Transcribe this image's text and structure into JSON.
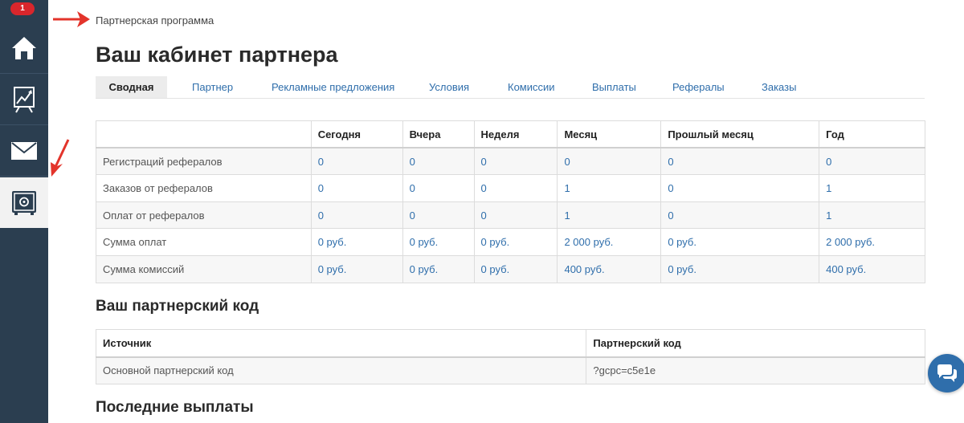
{
  "sidebar": {
    "badge": "1",
    "items": [
      {
        "icon": "home-icon"
      },
      {
        "icon": "chart-icon"
      },
      {
        "icon": "mail-icon"
      },
      {
        "icon": "safe-icon",
        "active": true
      }
    ],
    "colors": {
      "background": "#2b3e50",
      "active": "#f2f2f2",
      "badge": "#d9262c"
    }
  },
  "breadcrumb": "Партнерская программа",
  "page_title": "Ваш кабинет партнера",
  "tabs": [
    {
      "label": "Сводная",
      "active": true
    },
    {
      "label": "Партнер"
    },
    {
      "label": "Рекламные предложения"
    },
    {
      "label": "Условия"
    },
    {
      "label": "Комиссии"
    },
    {
      "label": "Выплаты"
    },
    {
      "label": "Рефералы"
    },
    {
      "label": "Заказы"
    }
  ],
  "stats": {
    "columns": [
      "",
      "Сегодня",
      "Вчера",
      "Неделя",
      "Месяц",
      "Прошлый месяц",
      "Год"
    ],
    "rows": [
      {
        "label": "Регистраций рефералов",
        "values": [
          "0",
          "0",
          "0",
          "0",
          "0",
          "0"
        ]
      },
      {
        "label": "Заказов от рефералов",
        "values": [
          "0",
          "0",
          "0",
          "1",
          "0",
          "1"
        ]
      },
      {
        "label": "Оплат от рефералов",
        "values": [
          "0",
          "0",
          "0",
          "1",
          "0",
          "1"
        ]
      },
      {
        "label": "Сумма оплат",
        "values": [
          "0 руб.",
          "0 руб.",
          "0 руб.",
          "2 000 руб.",
          "0 руб.",
          "2 000 руб."
        ]
      },
      {
        "label": "Сумма комиссий",
        "values": [
          "0 руб.",
          "0 руб.",
          "0 руб.",
          "400 руб.",
          "0 руб.",
          "400 руб."
        ]
      }
    ]
  },
  "partner_code": {
    "title": "Ваш партнерский код",
    "columns": [
      "Источник",
      "Партнерский код"
    ],
    "rows": [
      {
        "source": "Основной партнерский код",
        "code": "?gcpc=c5e1e"
      }
    ]
  },
  "last_payouts_title": "Последние выплаты",
  "colors": {
    "link": "#2f6eab",
    "arrow": "#e3342b"
  }
}
